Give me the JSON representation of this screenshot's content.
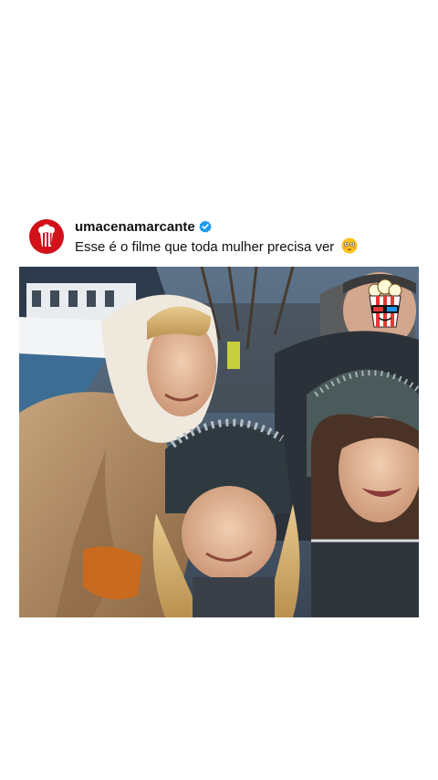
{
  "post": {
    "username": "umacenamarcante",
    "verified": true,
    "caption": "Esse é o filme que toda mulher precisa ver",
    "caption_emoji": "flushed-face-icon",
    "avatar_icon": "popcorn-icon"
  },
  "media": {
    "type": "video-frame",
    "sticker_icon": "popcorn-3d-glasses-icon"
  },
  "colors": {
    "avatar_bg": "#d2111a",
    "verified_blue": "#1d9bf0",
    "text": "#111111"
  }
}
